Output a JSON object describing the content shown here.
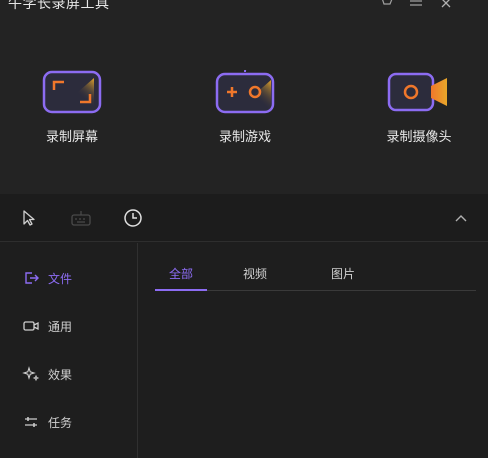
{
  "app": {
    "title": "牛学长录屏工具"
  },
  "window_controls": {
    "cart_icon": "cart-icon",
    "menu_icon": "hamburger-menu-icon",
    "close_icon": "close-icon"
  },
  "modes": [
    {
      "label": "录制屏幕",
      "icon": "record-screen-icon"
    },
    {
      "label": "录制游戏",
      "icon": "gamepad-icon"
    },
    {
      "label": "录制摄像头",
      "icon": "webcam-icon"
    }
  ],
  "toolbar": {
    "icons": [
      "cursor-icon",
      "keyboard-icon",
      "clock-icon",
      "chevron-up-icon"
    ]
  },
  "sidebar": {
    "items": [
      {
        "label": "文件",
        "icon": "export-icon",
        "active": true
      },
      {
        "label": "通用",
        "icon": "video-icon",
        "active": false
      },
      {
        "label": "效果",
        "icon": "sparkle-icon",
        "active": false
      },
      {
        "label": "任务",
        "icon": "sliders-icon",
        "active": false
      }
    ]
  },
  "tabs": [
    {
      "label": "全部",
      "active": true
    },
    {
      "label": "视频",
      "active": false
    },
    {
      "label": "图片",
      "active": false
    }
  ],
  "colors": {
    "accent": "#8c6cf2",
    "orange": "#f0772b",
    "gold": "#e8a72a",
    "background": "#1e1e1e",
    "panel": "#232323"
  }
}
